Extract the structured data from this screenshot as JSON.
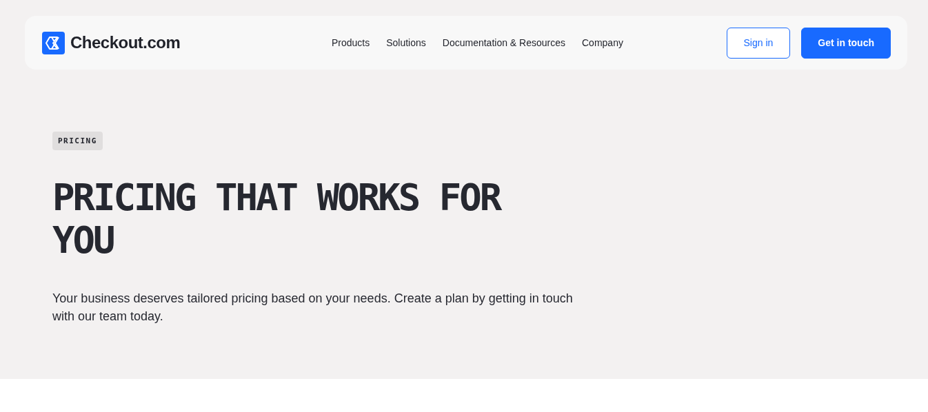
{
  "header": {
    "logo": "Checkout.com",
    "nav": [
      {
        "label": "Products"
      },
      {
        "label": "Solutions"
      },
      {
        "label": "Documentation & Resources"
      },
      {
        "label": "Company"
      }
    ],
    "buttons": [
      {
        "label": "Sign in",
        "kind": "outline"
      },
      {
        "label": "Get in touch",
        "kind": "primary"
      }
    ]
  },
  "hero": {
    "badge": "PRICING",
    "title": "PRICING THAT WORKS FOR YOU",
    "text": "Your business deserves tailored pricing based on your needs. Create a plan by getting in touch with our team today."
  }
}
